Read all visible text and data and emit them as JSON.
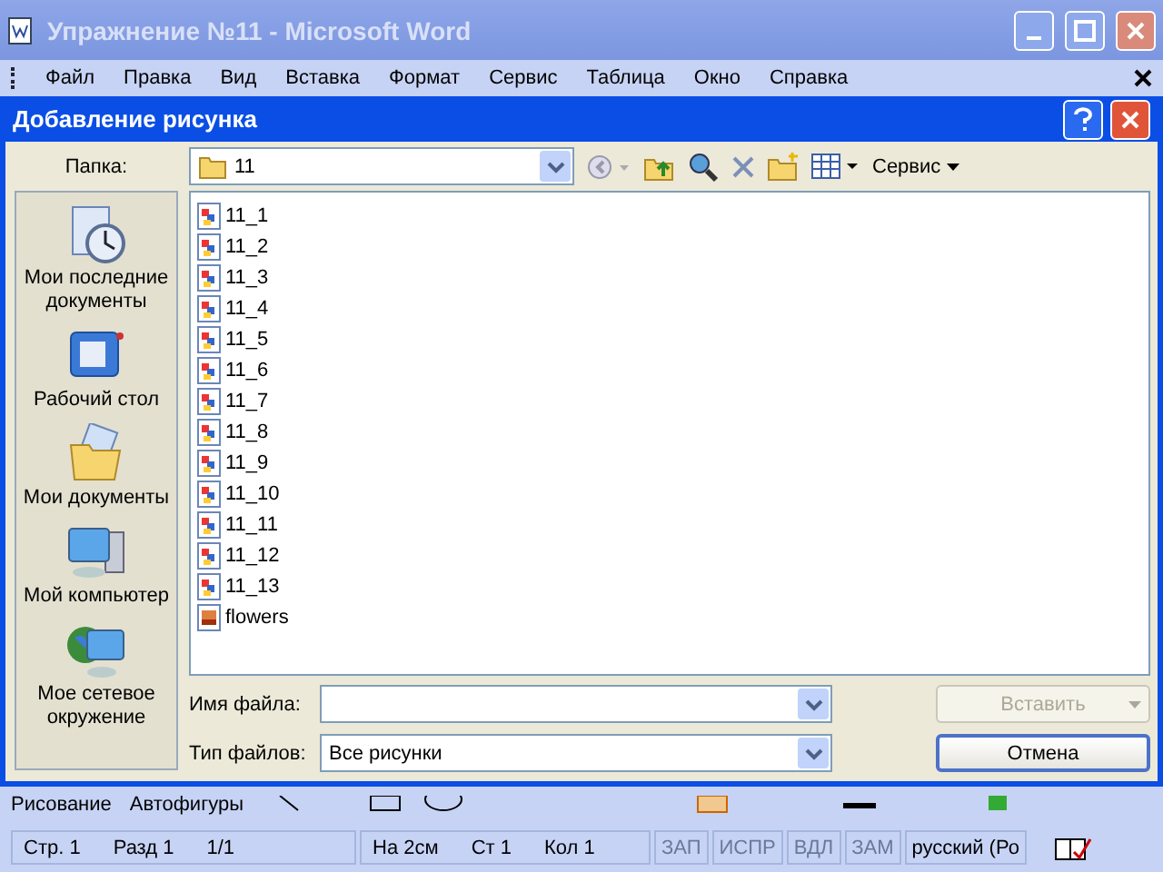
{
  "word_window": {
    "title": "Упражнение №11 - Microsoft Word",
    "menu": [
      "Файл",
      "Правка",
      "Вид",
      "Вставка",
      "Формат",
      "Сервис",
      "Таблица",
      "Окно",
      "Справка"
    ]
  },
  "dialog": {
    "title": "Добавление рисунка",
    "folder_label": "Папка:",
    "folder": "11",
    "tools_menu": "Сервис",
    "places": [
      {
        "kind": "recent",
        "label": "Мои последние документы"
      },
      {
        "kind": "desktop",
        "label": "Рабочий стол"
      },
      {
        "kind": "documents",
        "label": "Мои документы"
      },
      {
        "kind": "computer",
        "label": "Мой компьютер"
      },
      {
        "kind": "network",
        "label": "Мое сетевое окружение"
      }
    ],
    "files": [
      {
        "kind": "bitmap",
        "name": "11_1"
      },
      {
        "kind": "bitmap",
        "name": "11_2"
      },
      {
        "kind": "bitmap",
        "name": "11_3"
      },
      {
        "kind": "bitmap",
        "name": "11_4"
      },
      {
        "kind": "bitmap",
        "name": "11_5"
      },
      {
        "kind": "bitmap",
        "name": "11_6"
      },
      {
        "kind": "bitmap",
        "name": "11_7"
      },
      {
        "kind": "bitmap",
        "name": "11_8"
      },
      {
        "kind": "bitmap",
        "name": "11_9"
      },
      {
        "kind": "bitmap",
        "name": "11_10"
      },
      {
        "kind": "bitmap",
        "name": "11_11"
      },
      {
        "kind": "bitmap",
        "name": "11_12"
      },
      {
        "kind": "bitmap",
        "name": "11_13"
      },
      {
        "kind": "photo",
        "name": "flowers"
      }
    ],
    "filename_label": "Имя файла:",
    "filetype_label": "Тип файлов:",
    "filetype": "Все рисунки",
    "insert_button": {
      "label": "Вставить",
      "disabled": true
    },
    "cancel_button": "Отмена"
  },
  "drawing_toolbar": {
    "draw_menu": "Рисование",
    "autoshapes_menu": "Автофигуры"
  },
  "status_bar": [
    {
      "text": "Стр. 1",
      "disabled": false
    },
    {
      "text": "Разд 1",
      "disabled": false
    },
    {
      "text": "1/1",
      "disabled": false
    },
    {
      "text": "На 2см",
      "disabled": false
    },
    {
      "text": "Ст 1",
      "disabled": false
    },
    {
      "text": "Кол 1",
      "disabled": false
    },
    {
      "text": "ЗАП",
      "disabled": true
    },
    {
      "text": "ИСПР",
      "disabled": true
    },
    {
      "text": "ВДЛ",
      "disabled": true
    },
    {
      "text": "ЗАМ",
      "disabled": true
    },
    {
      "text": "русский (Ро",
      "disabled": false
    }
  ]
}
